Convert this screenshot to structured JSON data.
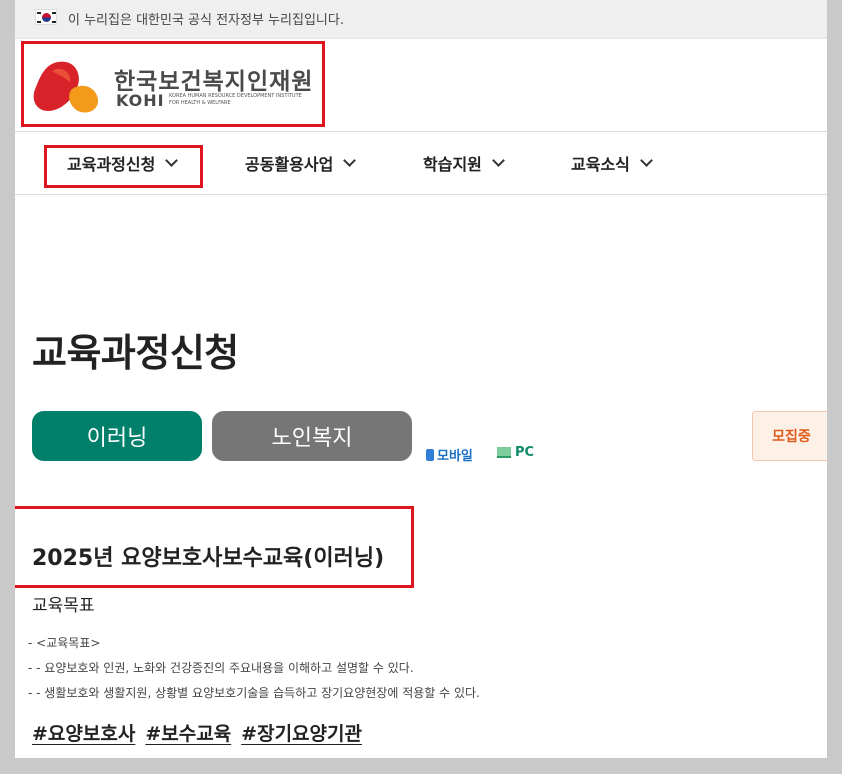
{
  "gov_banner": {
    "text": "이 누리집은 대한민국 공식 전자정부 누리집입니다."
  },
  "logo": {
    "name_kr": "한국보건복지인재원",
    "name_en": "KOHI",
    "subtitle_line1": "KOREA HUMAN RESOURCE DEVELOPMENT INSTITUTE",
    "subtitle_line2": "FOR HEALTH & WELFARE",
    "colors": {
      "red": "#d8232a",
      "orange": "#f39a1b"
    }
  },
  "nav": {
    "items": [
      {
        "label": "교육과정신청"
      },
      {
        "label": "공동활용사업"
      },
      {
        "label": "학습지원"
      },
      {
        "label": "교육소식"
      }
    ]
  },
  "main": {
    "page_title": "교육과정신청",
    "category_buttons": [
      {
        "label": "이러닝",
        "color": "#00806a"
      },
      {
        "label": "노인복지",
        "color": "#767676"
      }
    ],
    "devices": [
      {
        "label": "모바일",
        "icon": "mobile-icon"
      },
      {
        "label": "PC",
        "icon": "pc-icon"
      }
    ],
    "status_badge": "모집중",
    "course_title": "2025년 요양보호사보수교육(이러닝)",
    "goal_heading": "교육목표",
    "goal_lines": [
      "-  <교육목표>",
      "-  - 요양보호와 인권, 노화와 건강증진의 주요내용을 이해하고 설명할 수 있다.",
      "-  - 생활보호와 생활지원, 상황별 요양보호기술을 습득하고 장기요양현장에 적용할 수 있다."
    ],
    "tags": [
      "#요양보호사",
      "#보수교육",
      "#장기요양기관"
    ]
  },
  "highlight_color": "#e0141e"
}
